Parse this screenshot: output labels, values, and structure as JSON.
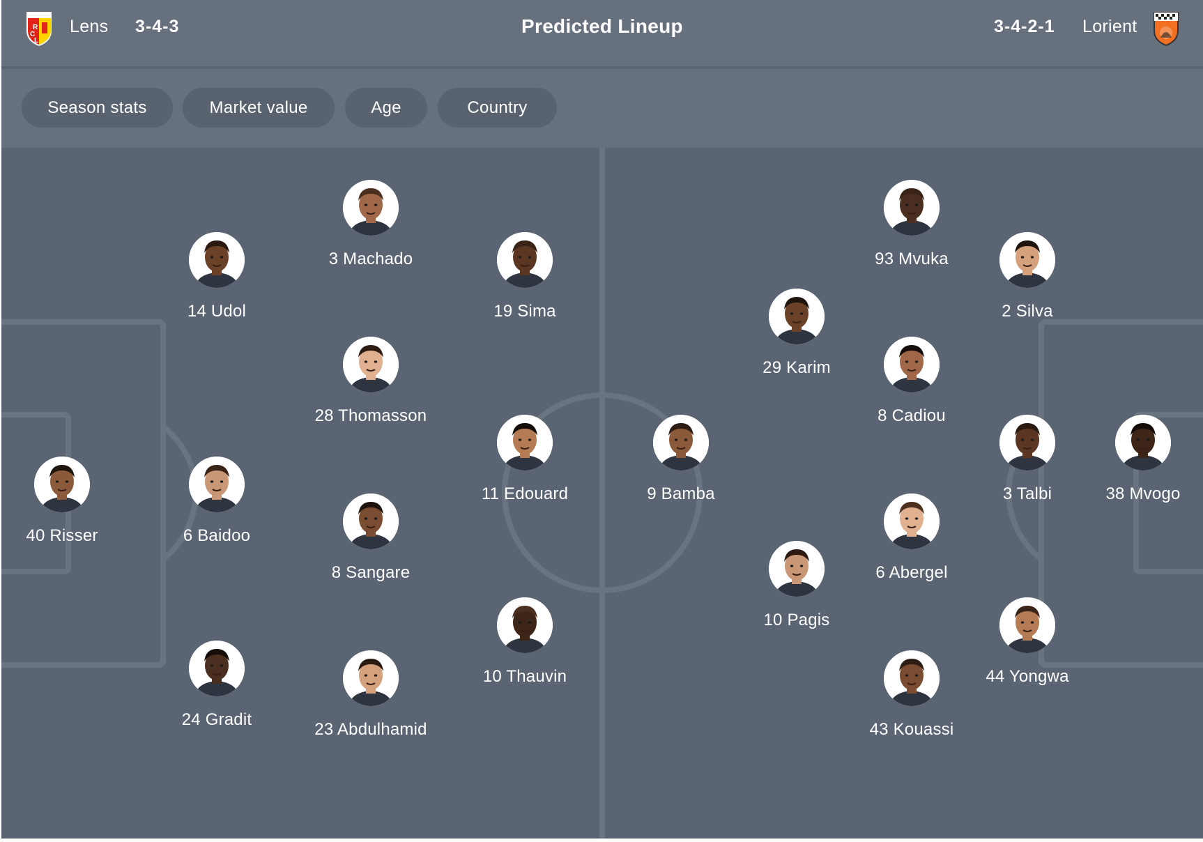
{
  "header": {
    "title": "Predicted Lineup",
    "home": {
      "name": "Lens",
      "formation": "3-4-3",
      "crest_icon": "lens-crest-icon"
    },
    "away": {
      "name": "Lorient",
      "formation": "3-4-2-1",
      "crest_icon": "lorient-crest-icon"
    }
  },
  "filters": [
    "Season stats",
    "Market value",
    "Age",
    "Country"
  ],
  "colors": {
    "card": "#5a6472",
    "header": "#67717e",
    "chip": "#59636f",
    "lines": "#6a7480",
    "lens_crest": "#e2231a",
    "lorient_crest": "#f36f21"
  },
  "players": {
    "home": [
      {
        "label": "40 Risser"
      },
      {
        "label": "14 Udol"
      },
      {
        "label": "6 Baidoo"
      },
      {
        "label": "24 Gradit"
      },
      {
        "label": "3 Machado"
      },
      {
        "label": "28 Thomasson"
      },
      {
        "label": "8 Sangare"
      },
      {
        "label": "23 Abdulhamid"
      },
      {
        "label": "19 Sima"
      },
      {
        "label": "11 Edouard"
      },
      {
        "label": "10 Thauvin"
      }
    ],
    "away": [
      {
        "label": "9 Bamba"
      },
      {
        "label": "29 Karim"
      },
      {
        "label": "10 Pagis"
      },
      {
        "label": "93 Mvuka"
      },
      {
        "label": "8 Cadiou"
      },
      {
        "label": "6 Abergel"
      },
      {
        "label": "43 Kouassi"
      },
      {
        "label": "2 Silva"
      },
      {
        "label": "3 Talbi"
      },
      {
        "label": "44 Yongwa"
      },
      {
        "label": "38 Mvogo"
      }
    ]
  }
}
